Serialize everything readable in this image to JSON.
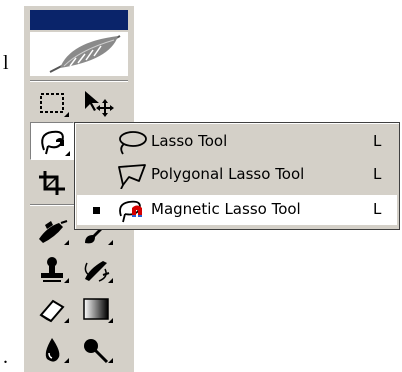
{
  "page": {
    "left_glyph": "l",
    "bottom_glyph": "."
  },
  "toolbox": {
    "logo": "feather-logo",
    "tools": [
      {
        "name": "rectangular-marquee-tool",
        "icon": "marquee-icon"
      },
      {
        "name": "move-tool",
        "icon": "move-icon"
      },
      {
        "name": "magnetic-lasso-tool",
        "icon": "magnetic-lasso-icon",
        "active": true
      },
      {
        "name": "crop-tool",
        "icon": "crop-icon"
      },
      {
        "name": "healing-brush-tool",
        "icon": "healing-brush-icon"
      },
      {
        "name": "brush-tool",
        "icon": "brush-icon"
      },
      {
        "name": "clone-stamp-tool",
        "icon": "stamp-icon"
      },
      {
        "name": "history-brush-tool",
        "icon": "history-brush-icon"
      },
      {
        "name": "eraser-tool",
        "icon": "eraser-icon"
      },
      {
        "name": "gradient-tool",
        "icon": "gradient-icon"
      },
      {
        "name": "blur-tool",
        "icon": "blur-icon"
      },
      {
        "name": "burn-tool",
        "icon": "burn-icon"
      }
    ]
  },
  "flyout": {
    "items": [
      {
        "label": "Lasso Tool",
        "shortcut": "L",
        "icon": "lasso-icon",
        "selected": false
      },
      {
        "label": "Polygonal Lasso Tool",
        "shortcut": "L",
        "icon": "polygonal-lasso-icon",
        "selected": false
      },
      {
        "label": "Magnetic Lasso Tool",
        "shortcut": "L",
        "icon": "magnetic-lasso-icon",
        "selected": true
      }
    ]
  },
  "colors": {
    "titlebar": "#0a246a",
    "panel": "#d4d0c8",
    "highlight": "#ffffff"
  }
}
